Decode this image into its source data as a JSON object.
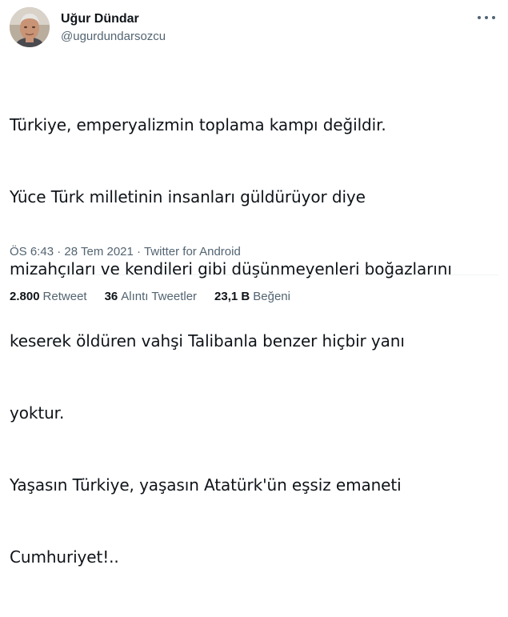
{
  "author": {
    "display_name": "Uğur Dündar",
    "handle": "@ugurdundarsozcu",
    "avatar_icon": "profile-photo"
  },
  "more_icon": "more-horizontal-icon",
  "tweet": {
    "lines": [
      "Türkiye, emperyalizmin toplama kampı değildir.",
      "Yüce Türk milletinin insanları güldürüyor diye",
      "mizahçıları ve kendileri gibi düşünmeyenleri boğazlarını",
      "keserek öldüren vahşi Talibanla benzer hiçbir yanı",
      "yoktur.",
      "Yaşasın Türkiye, yaşasın Atatürk'ün eşsiz emaneti",
      "Cumhuriyet!.."
    ]
  },
  "meta": {
    "time": "ÖS 6:43",
    "separator": "·",
    "date": "28 Tem 2021",
    "source": "Twitter for Android"
  },
  "stats": {
    "retweets_count": "2.800",
    "retweets_label": "Retweet",
    "quotes_count": "36",
    "quotes_label": "Alıntı Tweetler",
    "likes_count": "23,1 B",
    "likes_label": "Beğeni"
  },
  "colors": {
    "text": "#0f1419",
    "secondary": "#536471",
    "divider": "#eff3f4"
  }
}
